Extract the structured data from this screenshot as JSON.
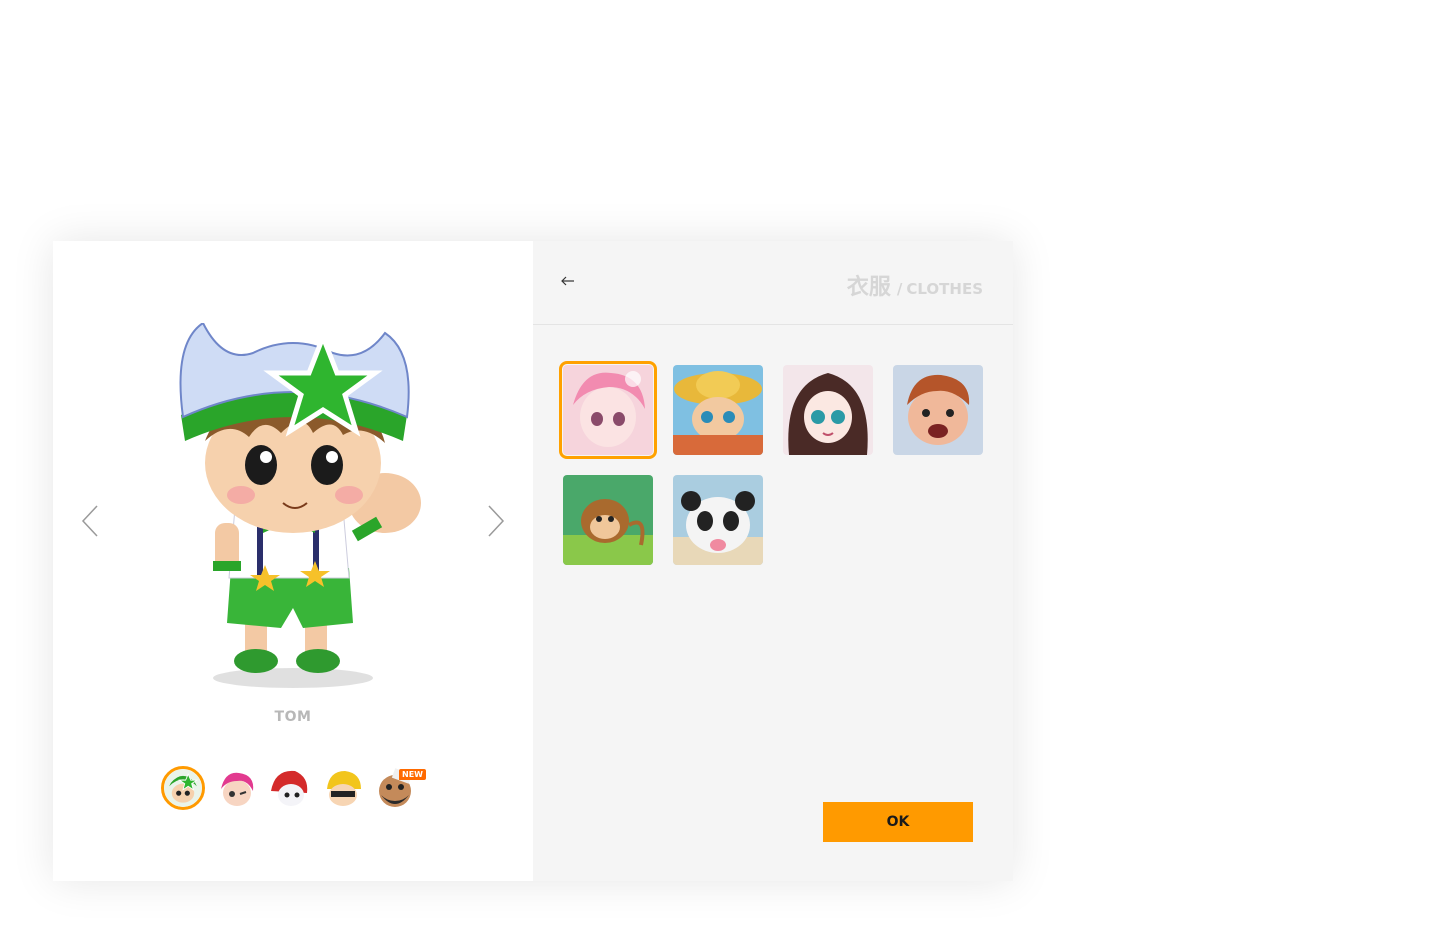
{
  "character": {
    "name": "TOM",
    "avatars": [
      {
        "name": "tom",
        "selected": true
      },
      {
        "name": "pink-girl",
        "selected": false
      },
      {
        "name": "red-ninja",
        "selected": false
      },
      {
        "name": "yellow-helmet",
        "selected": false
      },
      {
        "name": "bearded-man",
        "selected": false,
        "badge": "NEW"
      }
    ]
  },
  "panel": {
    "title_zh": "衣服",
    "separator": "/",
    "title_en": "CLOTHES",
    "ok_label": "OK"
  },
  "clothes": [
    {
      "name": "pink-doll",
      "selected": true
    },
    {
      "name": "straw-hat-boy",
      "selected": false
    },
    {
      "name": "dark-hair-girl",
      "selected": false
    },
    {
      "name": "angry-boy",
      "selected": false
    },
    {
      "name": "monkey",
      "selected": false
    },
    {
      "name": "panda",
      "selected": false
    }
  ],
  "colors": {
    "accent": "#ff9a00",
    "badge": "#ff6a00"
  }
}
